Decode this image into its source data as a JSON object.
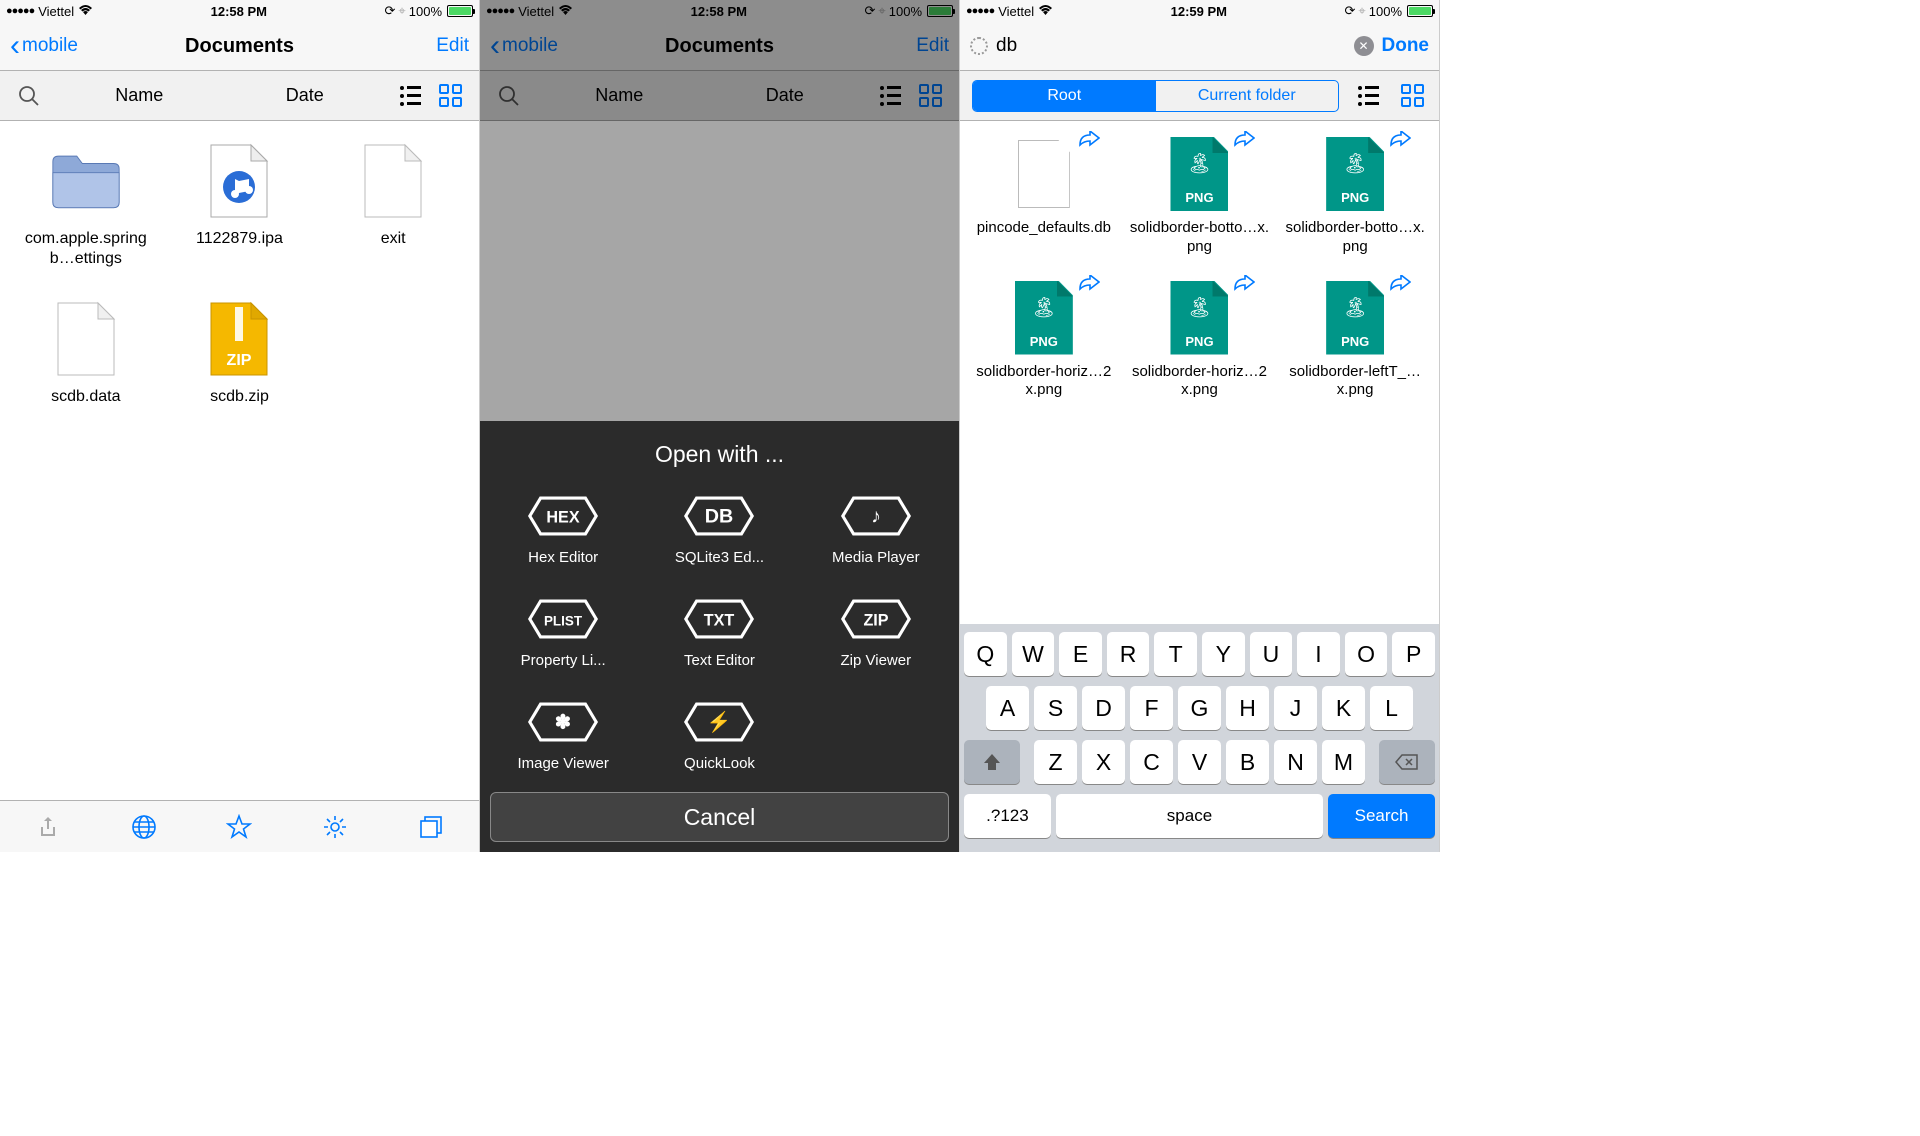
{
  "status": {
    "carrier": "Viettel",
    "time1": "12:58 PM",
    "time2": "12:58 PM",
    "time3": "12:59 PM",
    "battery": "100%"
  },
  "screen1": {
    "back": "mobile",
    "title": "Documents",
    "edit": "Edit",
    "sort_name": "Name",
    "sort_date": "Date",
    "files": [
      {
        "name": "com.apple.springb…ettings",
        "type": "folder"
      },
      {
        "name": "1122879.ipa",
        "type": "ipa"
      },
      {
        "name": "exit",
        "type": "blank"
      },
      {
        "name": "scdb.data",
        "type": "blank"
      },
      {
        "name": "scdb.zip",
        "type": "zip"
      }
    ]
  },
  "screen2": {
    "back": "mobile",
    "title": "Documents",
    "edit": "Edit",
    "sheet_title": "Open with ...",
    "apps": [
      {
        "label": "Hex Editor",
        "badge": "HEX"
      },
      {
        "label": "SQLite3 Ed...",
        "badge": "DB"
      },
      {
        "label": "Media Player",
        "badge": "♪"
      },
      {
        "label": "Property Li...",
        "badge": "PLIST"
      },
      {
        "label": "Text Editor",
        "badge": "TXT"
      },
      {
        "label": "Zip Viewer",
        "badge": "ZIP"
      },
      {
        "label": "Image Viewer",
        "badge": "✽"
      },
      {
        "label": "QuickLook",
        "badge": "⚡"
      }
    ],
    "cancel": "Cancel"
  },
  "screen3": {
    "search_value": "db",
    "done": "Done",
    "seg_root": "Root",
    "seg_current": "Current folder",
    "results": [
      {
        "name": "pincode_defaults.db",
        "type": "db"
      },
      {
        "name": "solidborder-botto…x.png",
        "type": "png"
      },
      {
        "name": "solidborder-botto…x.png",
        "type": "png"
      },
      {
        "name": "solidborder-horiz…2x.png",
        "type": "png"
      },
      {
        "name": "solidborder-horiz…2x.png",
        "type": "png"
      },
      {
        "name": "solidborder-leftT_…x.png",
        "type": "png"
      }
    ],
    "keyboard": {
      "row1": [
        "Q",
        "W",
        "E",
        "R",
        "T",
        "Y",
        "U",
        "I",
        "O",
        "P"
      ],
      "row2": [
        "A",
        "S",
        "D",
        "F",
        "G",
        "H",
        "J",
        "K",
        "L"
      ],
      "row3": [
        "Z",
        "X",
        "C",
        "V",
        "B",
        "N",
        "M"
      ],
      "num": ".?123",
      "space": "space",
      "search": "Search"
    }
  }
}
